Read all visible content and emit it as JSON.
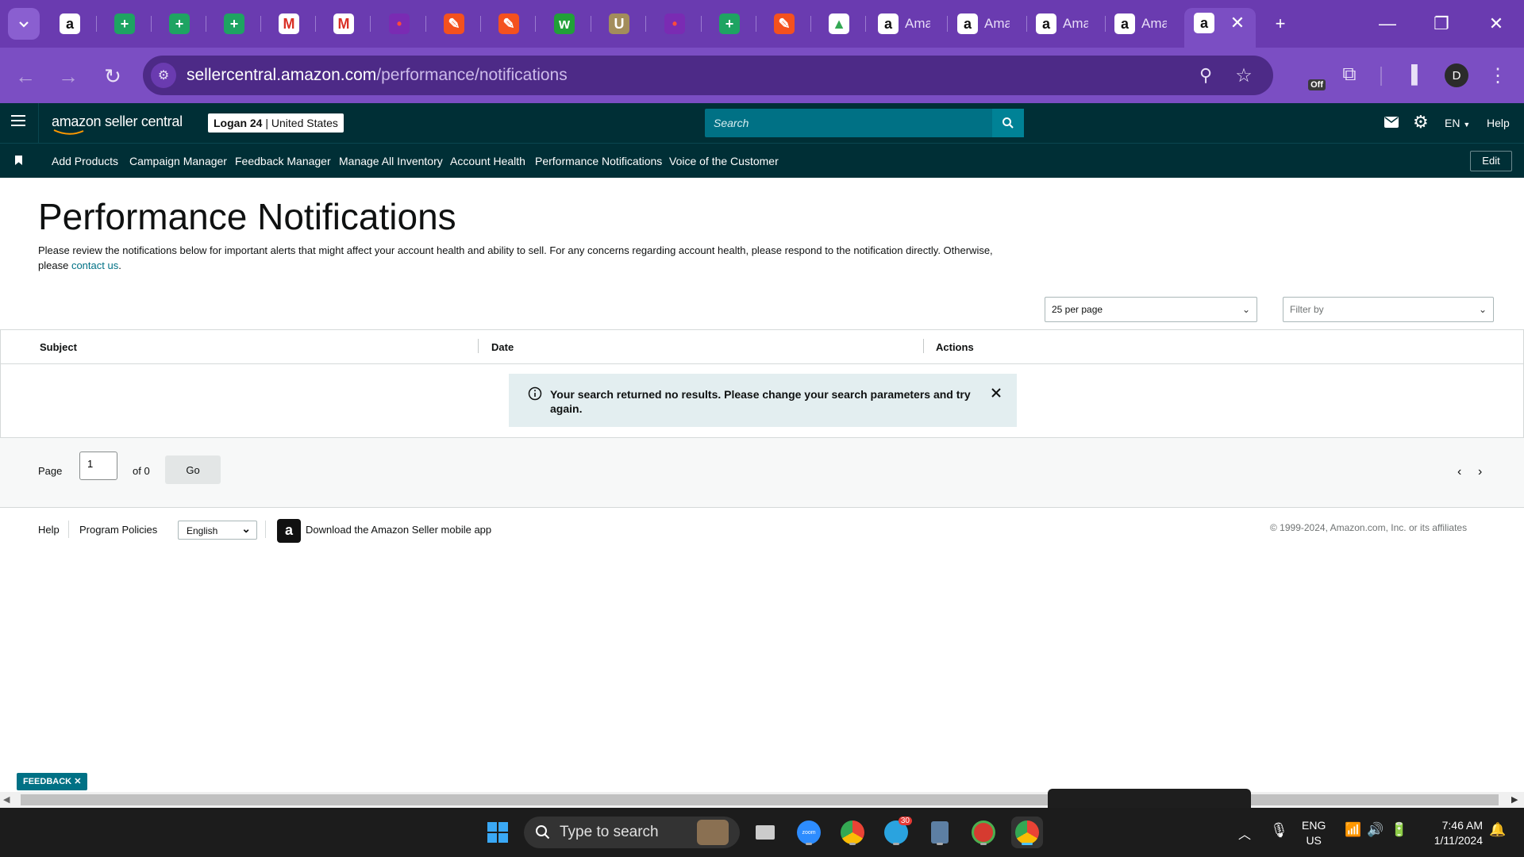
{
  "browser": {
    "tabs": [
      {
        "icon": "amazon-icon",
        "label": ""
      },
      {
        "icon": "sheets-icon",
        "label": ""
      },
      {
        "icon": "sheets-icon",
        "label": ""
      },
      {
        "icon": "sheets-icon",
        "label": ""
      },
      {
        "icon": "gmail-icon",
        "label": ""
      },
      {
        "icon": "gmail-icon",
        "label": ""
      },
      {
        "icon": "app-icon",
        "label": ""
      },
      {
        "icon": "tasks-icon",
        "label": ""
      },
      {
        "icon": "tasks-icon",
        "label": ""
      },
      {
        "icon": "w-icon",
        "label": ""
      },
      {
        "icon": "uline-icon",
        "label": ""
      },
      {
        "icon": "app-icon",
        "label": ""
      },
      {
        "icon": "sheets-icon",
        "label": ""
      },
      {
        "icon": "tasks-icon",
        "label": ""
      },
      {
        "icon": "drive-icon",
        "label": ""
      },
      {
        "icon": "amazon-icon",
        "label": "Ama"
      },
      {
        "icon": "amazon-icon",
        "label": "Ama"
      },
      {
        "icon": "amazon-icon",
        "label": "Ama"
      },
      {
        "icon": "amazon-icon",
        "label": "Ama"
      }
    ],
    "url_host": "sellercentral.amazon.com",
    "url_path": "/performance/notifications",
    "extension_badge": "Off",
    "profile_initial": "D"
  },
  "header": {
    "logo_text": "amazon seller central",
    "store_name": "Logan 24",
    "store_region": "| United States",
    "search_placeholder": "Search",
    "language": "EN",
    "help": "Help"
  },
  "nav": {
    "items": [
      "Add Products",
      "Campaign Manager",
      "Feedback Manager",
      "Manage All Inventory",
      "Account Health",
      "Performance Notifications",
      "Voice of the Customer"
    ],
    "edit_label": "Edit"
  },
  "main": {
    "title": "Performance Notifications",
    "intro": "Please review the notifications below for important alerts that might affect your account health and ability to sell. For any concerns regarding account health, please respond to the notification directly. Otherwise, please",
    "intro_link": "contact us",
    "intro_end": ".",
    "per_page": "25 per page",
    "filter_placeholder": "Filter by",
    "columns": [
      "Subject",
      "Date",
      "Actions"
    ],
    "alert_text": "Your search returned no results. Please change your search parameters and try again.",
    "page_label": "Page",
    "page_value": "1",
    "page_of": "of 0",
    "go_label": "Go"
  },
  "footer": {
    "help": "Help",
    "program_policies": "Program Policies",
    "language": "English",
    "download_app": "Download the Amazon Seller mobile app",
    "copyright": "© 1999-2024, Amazon.com, Inc. or its affiliates"
  },
  "feedback_label": "FEEDBACK",
  "taskbar": {
    "search_placeholder": "Type to search",
    "telegram_badge": "30",
    "lang_top": "ENG",
    "lang_bottom": "US",
    "time": "7:46 AM",
    "date": "1/11/2024"
  }
}
